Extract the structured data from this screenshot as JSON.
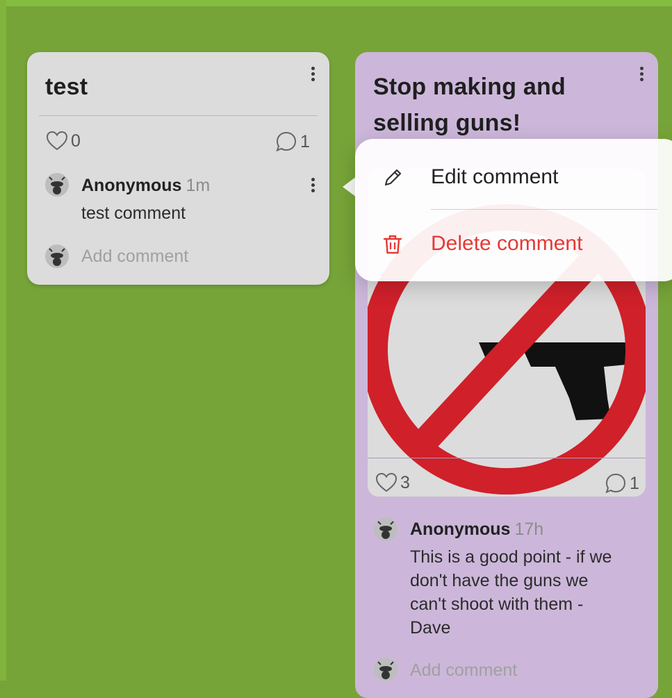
{
  "colors": {
    "board_background": "#77a438",
    "card_gray": "#dcdcdc",
    "card_purple": "#ccb7da",
    "danger": "#e53935"
  },
  "cards": [
    {
      "title": "test",
      "likes": "0",
      "comments_count": "1",
      "comments": [
        {
          "author": "Anonymous",
          "time": "1m",
          "text": "test comment"
        }
      ],
      "add_comment_placeholder": "Add comment"
    },
    {
      "title": "Stop making and selling guns!",
      "image": "no-guns-sign",
      "likes": "3",
      "comments_count": "1",
      "comments": [
        {
          "author": "Anonymous",
          "time": "17h",
          "text_lines": [
            "This is a good point - if we",
            "don't have the guns we",
            "can't shoot with them -",
            "Dave"
          ]
        }
      ],
      "add_comment_placeholder": "Add comment"
    }
  ],
  "context_menu": {
    "items": [
      {
        "label": "Edit comment",
        "icon": "pencil-icon"
      },
      {
        "label": "Delete comment",
        "icon": "trash-icon"
      }
    ]
  }
}
